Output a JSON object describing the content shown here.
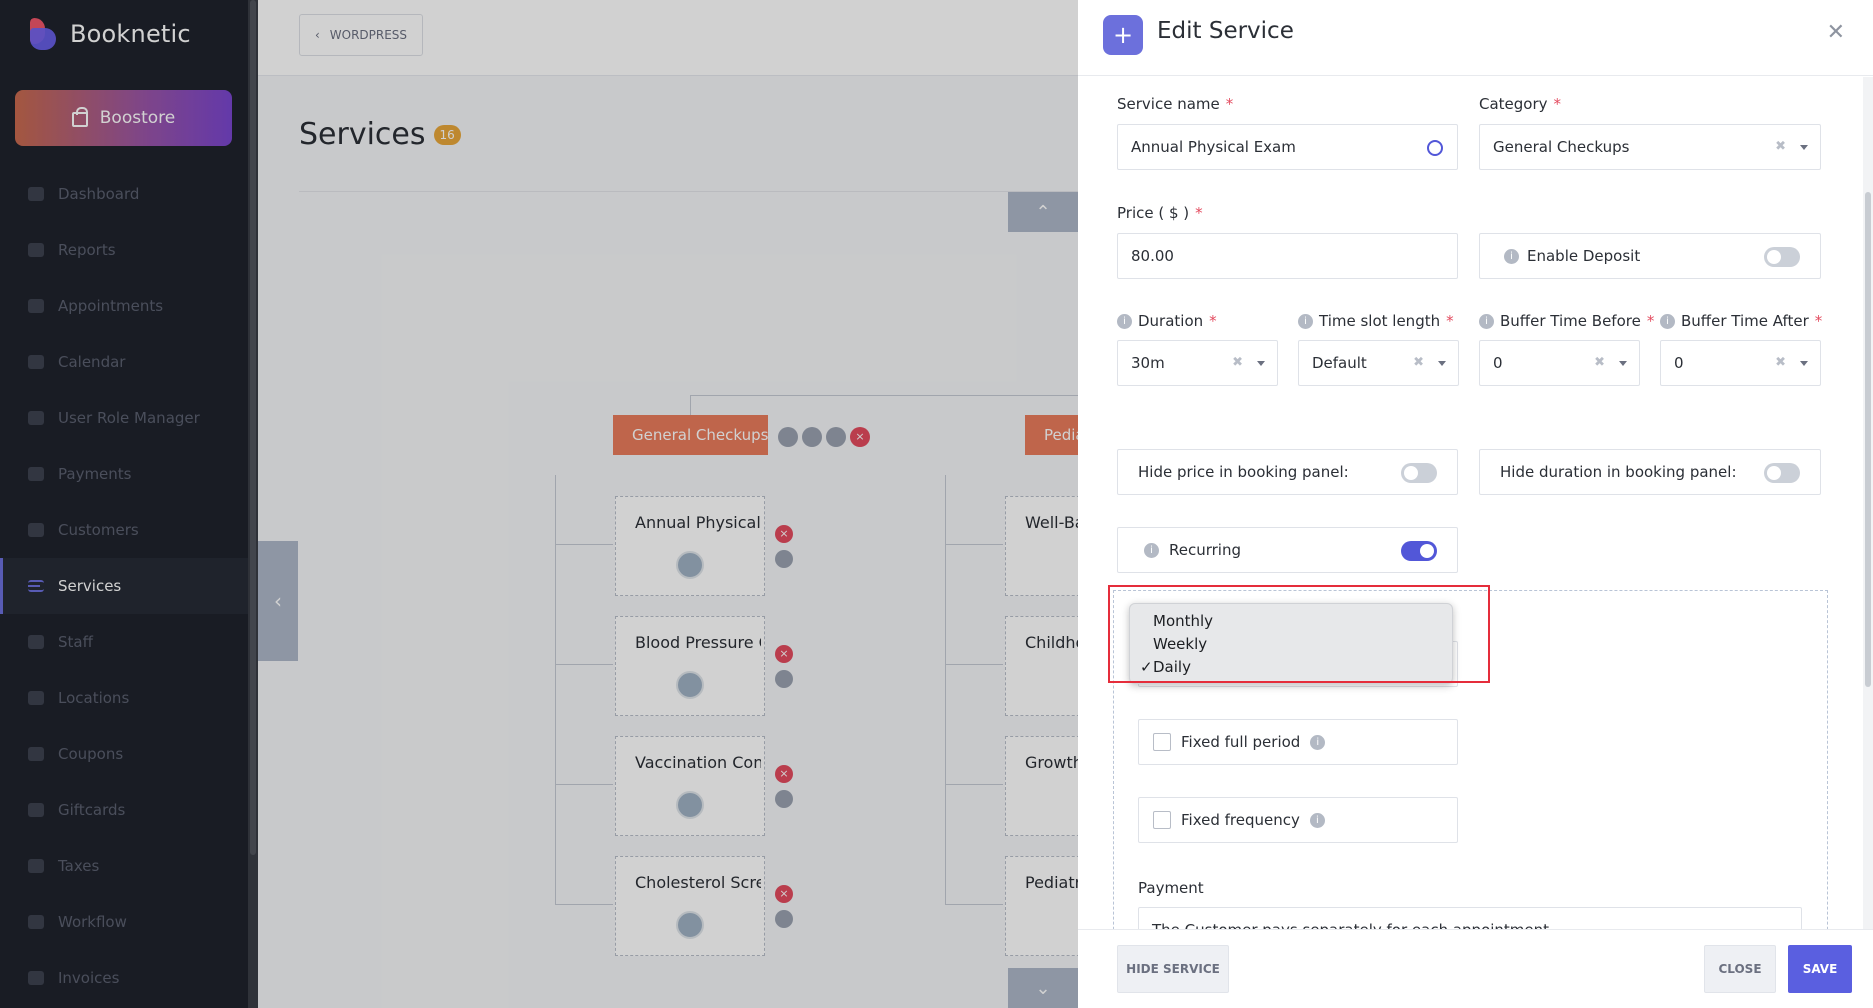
{
  "brand": {
    "name": "Booknetic"
  },
  "boostore": {
    "label": "Boostore"
  },
  "menu": [
    {
      "label": "Dashboard",
      "icon": "dashboard-icon"
    },
    {
      "label": "Reports",
      "icon": "reports-icon"
    },
    {
      "label": "Appointments",
      "icon": "appointments-icon"
    },
    {
      "label": "Calendar",
      "icon": "calendar-icon"
    },
    {
      "label": "User Role Manager",
      "icon": "user-role-icon"
    },
    {
      "label": "Payments",
      "icon": "payments-icon"
    },
    {
      "label": "Customers",
      "icon": "customers-icon"
    },
    {
      "label": "Services",
      "icon": "services-icon",
      "active": true
    },
    {
      "label": "Staff",
      "icon": "staff-icon"
    },
    {
      "label": "Locations",
      "icon": "locations-icon"
    },
    {
      "label": "Coupons",
      "icon": "coupons-icon"
    },
    {
      "label": "Giftcards",
      "icon": "giftcards-icon"
    },
    {
      "label": "Taxes",
      "icon": "taxes-icon"
    },
    {
      "label": "Workflow",
      "icon": "workflow-icon"
    },
    {
      "label": "Invoices",
      "icon": "invoices-icon"
    }
  ],
  "topbar": {
    "wp_label": "WORDPRESS"
  },
  "page": {
    "title": "Services",
    "count": "16"
  },
  "categories": [
    {
      "label": "General Checkups"
    },
    {
      "label": "Pediatrics"
    }
  ],
  "services_left": [
    "Annual Physical Exam",
    "Blood Pressure Check",
    "Vaccination Consultation",
    "Cholesterol Screening"
  ],
  "services_right": [
    "Well-Baby Visit",
    "Childhood Immunizations",
    "Growth Monitoring",
    "Pediatric Consultation"
  ],
  "modal": {
    "title": "Edit Service",
    "service_name_label": "Service name",
    "service_name_value": "Annual Physical Exam",
    "category_label": "Category",
    "category_value": "General Checkups",
    "price_label": "Price ( $ )",
    "price_value": "80.00",
    "enable_deposit_label": "Enable Deposit",
    "duration_label": "Duration",
    "duration_value": "30m",
    "timeslot_label": "Time slot length",
    "timeslot_value": "Default",
    "buffer_before_label": "Buffer Time Before",
    "buffer_before_value": "0",
    "buffer_after_label": "Buffer Time After",
    "buffer_after_value": "0",
    "hide_price_label": "Hide price in booking panel:",
    "hide_duration_label": "Hide duration in booking panel:",
    "recurring_label": "Recurring",
    "recurring_on": true,
    "frequency_options": [
      "Monthly",
      "Weekly",
      "Daily"
    ],
    "frequency_selected": "Daily",
    "fixed_full_period_label": "Fixed full period",
    "fixed_frequency_label": "Fixed frequency",
    "payment_label": "Payment",
    "payment_value": "The Customer pays separately for each appointment",
    "hide_service_button": "HIDE SERVICE",
    "close_button": "CLOSE",
    "save_button": "SAVE"
  },
  "colors": {
    "accent": "#5257d8",
    "danger": "#e34b5f",
    "category": "#ea7c5c",
    "highlight": "#e52d3b"
  }
}
